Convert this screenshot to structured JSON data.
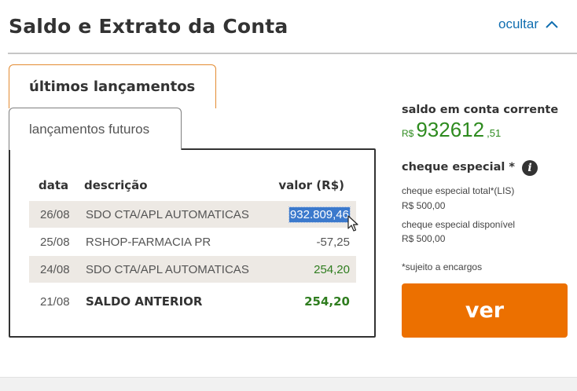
{
  "header": {
    "title": "Saldo e Extrato da Conta",
    "hide_label": "ocultar"
  },
  "tabs": [
    {
      "label": "últimos lançamentos",
      "active": true
    },
    {
      "label": "lançamentos futuros",
      "active": false
    }
  ],
  "statement": {
    "columns": {
      "date": "data",
      "description": "descrição",
      "value": "valor (R$)"
    },
    "rows": [
      {
        "date": "26/08",
        "description": "SDO CTA/APL AUTOMATICAS",
        "value": "932.809,46",
        "selected": true
      },
      {
        "date": "25/08",
        "description": "RSHOP-FARMACIA PR",
        "value": "-57,25"
      },
      {
        "date": "24/08",
        "description": "SDO CTA/APL AUTOMATICAS",
        "value": "254,20"
      },
      {
        "date": "21/08",
        "description": "SALDO ANTERIOR",
        "value": "254,20"
      }
    ]
  },
  "account": {
    "balance_label": "saldo em conta corrente",
    "currency": "R$",
    "balance_integer": "932612",
    "balance_cents": ",51",
    "overdraft_title": "cheque especial *",
    "overdraft_total_label": "cheque especial total*(LIS)",
    "overdraft_total_value": "R$ 500,00",
    "overdraft_available_label": "cheque especial disponível",
    "overdraft_available_value": "R$ 500,00",
    "footnote": "*sujeito a encargos",
    "button_label": "ver"
  },
  "icons": {
    "hide": "chevron-up-icon",
    "info": "info-icon",
    "cursor": "mouse-pointer-icon"
  },
  "colors": {
    "accent_orange": "#ec7000",
    "link_blue": "#106eb0",
    "balance_green": "#2e8b1f",
    "selection_blue": "#3b79cc",
    "row_shade": "#ede9e4"
  }
}
